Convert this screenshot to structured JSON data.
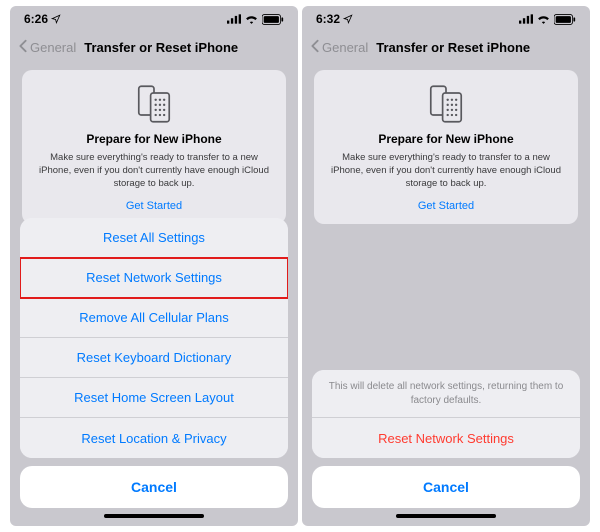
{
  "left": {
    "status": {
      "time": "6:26",
      "loc_icon": "location-arrow-outline"
    },
    "nav": {
      "back": "General",
      "title": "Transfer or Reset iPhone"
    },
    "card": {
      "title": "Prepare for New iPhone",
      "desc": "Make sure everything's ready to transfer to a new iPhone, even if you don't currently have enough iCloud storage to back up.",
      "cta": "Get Started"
    },
    "sheet": {
      "items": [
        {
          "label": "Reset All Settings"
        },
        {
          "label": "Reset Network Settings",
          "highlight": true
        },
        {
          "label": "Remove All Cellular Plans"
        },
        {
          "label": "Reset Keyboard Dictionary"
        },
        {
          "label": "Reset Home Screen Layout"
        },
        {
          "label": "Reset Location & Privacy"
        }
      ],
      "cancel": "Cancel"
    }
  },
  "right": {
    "status": {
      "time": "6:32",
      "loc_icon": "location-arrow-outline"
    },
    "nav": {
      "back": "General",
      "title": "Transfer or Reset iPhone"
    },
    "card": {
      "title": "Prepare for New iPhone",
      "desc": "Make sure everything's ready to transfer to a new iPhone, even if you don't currently have enough iCloud storage to back up.",
      "cta": "Get Started"
    },
    "confirm": {
      "message": "This will delete all network settings, returning them to factory defaults.",
      "action": "Reset Network Settings",
      "cancel": "Cancel"
    }
  }
}
